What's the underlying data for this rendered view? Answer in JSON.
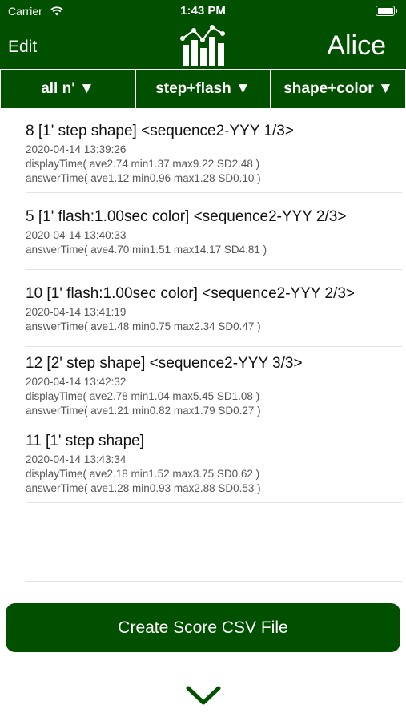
{
  "status_bar": {
    "carrier": "Carrier",
    "time": "1:43 PM"
  },
  "nav": {
    "edit_label": "Edit",
    "user_name": "Alice"
  },
  "filters": [
    {
      "label": "all n' ▼"
    },
    {
      "label": "step+flash ▼"
    },
    {
      "label": "shape+color ▼"
    }
  ],
  "records": [
    {
      "title": "8   [1' step shape] <sequence2-YYY 1/3>",
      "timestamp": "2020-04-14 13:39:26",
      "lines": [
        "displayTime( ave2.74 min1.37 max9.22 SD2.48 )",
        "answerTime( ave1.12 min0.96 max1.28 SD0.10 )"
      ]
    },
    {
      "title": "5   [1' flash:1.00sec color] <sequence2-YYY 2/3>",
      "timestamp": "2020-04-14 13:40:33",
      "lines": [
        "answerTime( ave4.70 min1.51 max14.17 SD4.81 )"
      ]
    },
    {
      "title": "10   [1' flash:1.00sec color] <sequence2-YYY 2/3>",
      "timestamp": "2020-04-14 13:41:19",
      "lines": [
        "answerTime( ave1.48 min0.75 max2.34 SD0.47 )"
      ]
    },
    {
      "title": "12   [2' step shape] <sequence2-YYY 3/3>",
      "timestamp": "2020-04-14 13:42:32",
      "lines": [
        "displayTime( ave2.78 min1.04 max5.45 SD1.08 )",
        "answerTime( ave1.21 min0.82 max1.79 SD0.27 )"
      ]
    },
    {
      "title": "11   [1' step shape]",
      "timestamp": "2020-04-14 13:43:34",
      "lines": [
        "displayTime( ave2.18 min1.52 max3.75 SD0.62 )",
        "answerTime( ave1.28 min0.93 max2.88 SD0.53 )"
      ]
    }
  ],
  "cta": {
    "label": "Create Score CSV File"
  },
  "colors": {
    "brand": "#005000",
    "background": "#ffffff",
    "meta_text": "#555555"
  }
}
